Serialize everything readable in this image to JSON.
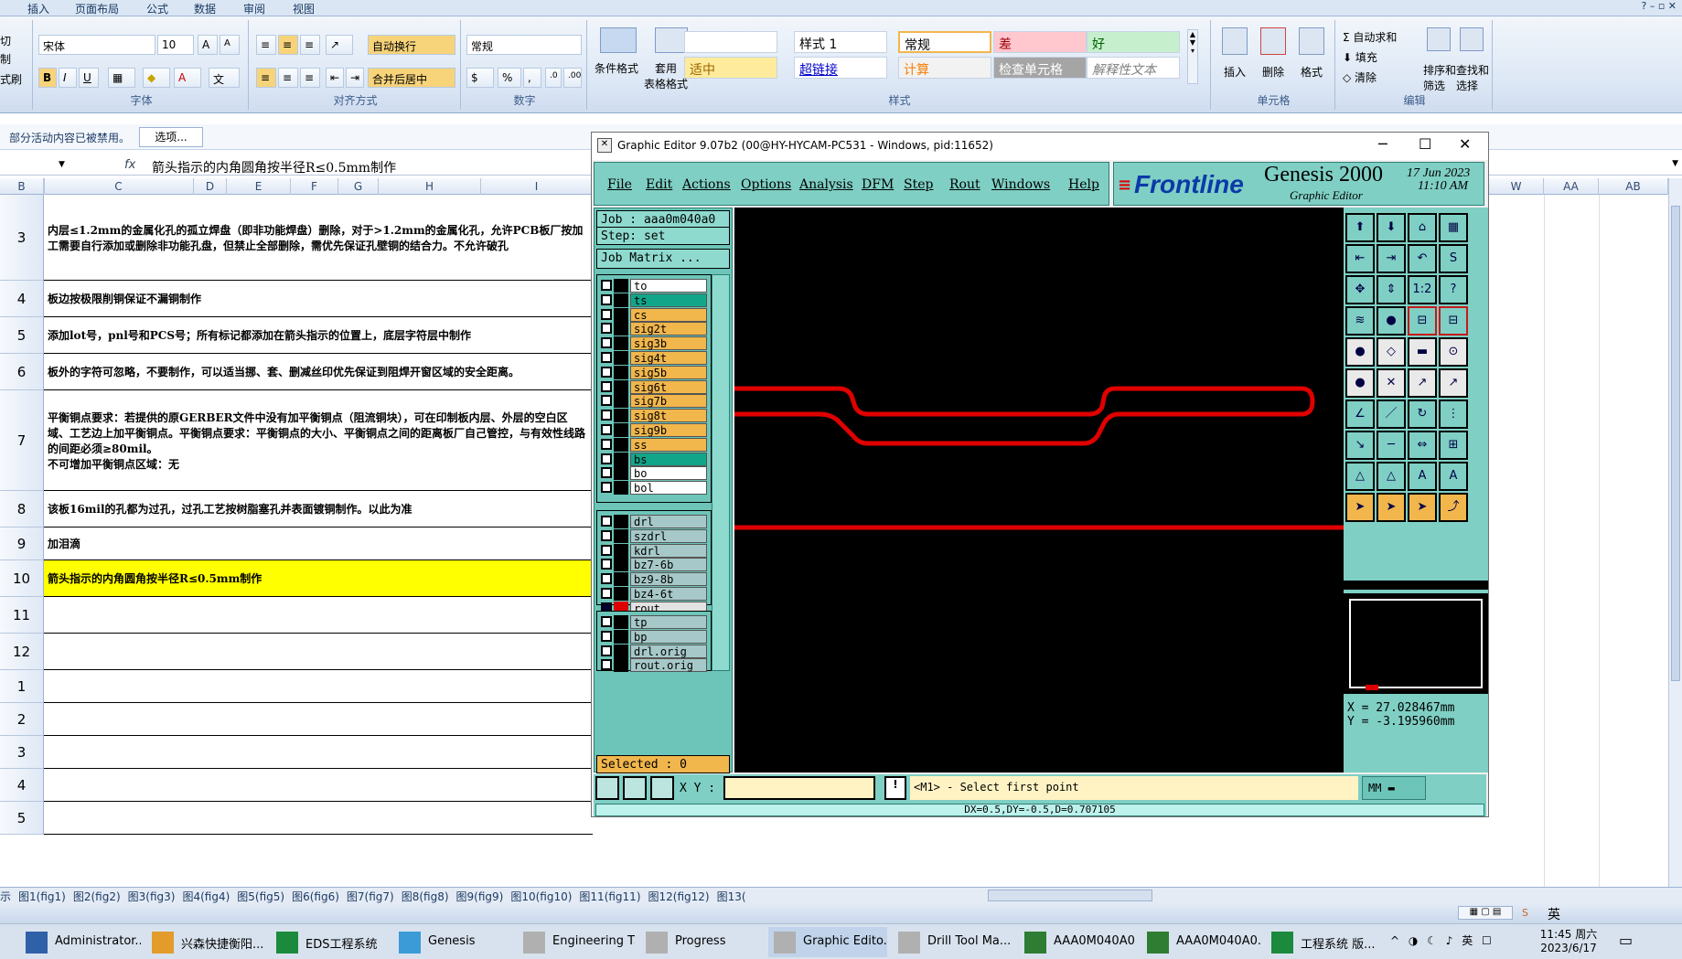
{
  "excel": {
    "tabs": [
      "插入",
      "页面布局",
      "公式",
      "数据",
      "审阅",
      "视图"
    ],
    "clipboard": {
      "cut": "切",
      "copy": "制",
      "format_painter": "式刷"
    },
    "font": {
      "name": "宋体",
      "size": "10",
      "group_label": "字体"
    },
    "alignment": {
      "wrap_text": "自动换行",
      "merge_center": "合并后居中",
      "group_label": "对齐方式"
    },
    "number": {
      "format": "常规",
      "group_label": "数字"
    },
    "styles": {
      "conditional_format": "条件格式",
      "table_format": "套用\n表格格式",
      "cells": [
        {
          "text": "",
          "bg": "#ffffff",
          "color": "#000000"
        },
        {
          "text": "样式 1",
          "bg": "#ffffff",
          "color": "#000000"
        },
        {
          "text": "常规",
          "bg": "#ffffff",
          "color": "#000000"
        },
        {
          "text": "差",
          "bg": "#ffc7ce",
          "color": "#9c0006"
        },
        {
          "text": "好",
          "bg": "#c6efce",
          "color": "#006100"
        },
        {
          "text": "适中",
          "bg": "#ffeb9c",
          "color": "#9c6500"
        },
        {
          "text": "超链接",
          "bg": "#ffffff",
          "color": "#0000cc"
        },
        {
          "text": "计算",
          "bg": "#f2f2f2",
          "color": "#fa7d00"
        },
        {
          "text": "检查单元格",
          "bg": "#a5a5a5",
          "color": "#ffffff"
        },
        {
          "text": "解释性文本",
          "bg": "#ffffff",
          "color": "#7f7f7f"
        }
      ],
      "group_label": "样式"
    },
    "cells_group": {
      "insert": "插入",
      "delete": "删除",
      "format": "格式",
      "group_label": "单元格"
    },
    "editing": {
      "autosum": "自动求和",
      "fill": "填充",
      "clear": "清除",
      "sort_filter": "排序和\n筛选",
      "find_select": "查找和\n选择",
      "group_label": "编辑"
    },
    "security_bar": {
      "message": "部分活动内容已被禁用。",
      "options_button": "选项..."
    },
    "formula_bar": {
      "fx": "fx",
      "content": "箭头指示的内角圆角按半径R≤0.5mm制作"
    },
    "columns": [
      "B",
      "C",
      "D",
      "E",
      "F",
      "G",
      "H",
      "I",
      "W",
      "AA",
      "AB"
    ],
    "rows": [
      {
        "num": "3",
        "text": "内层≤1.2mm的金属化孔的孤立焊盘（即非功能焊盘）删除，对于>1.2mm的金属化孔，允许PCB板厂按加工需要自行添加或删除非功能孔盘，但禁止全部删除，需优先保证孔壁铜的结合力。不允许破孔",
        "highlight": false
      },
      {
        "num": "4",
        "text": "板边按极限削铜保证不漏铜制作",
        "highlight": false
      },
      {
        "num": "5",
        "text": "添加lot号，pnl号和PCS号；所有标记都添加在箭头指示的位置上，底层字符层中制作",
        "highlight": false
      },
      {
        "num": "6",
        "text": "板外的字符可忽略，不要制作，可以适当挪、套、删减丝印优先保证到阻焊开窗区域的安全距离。",
        "highlight": false
      },
      {
        "num": "7",
        "text": "平衡铜点要求：若提供的原GERBER文件中没有加平衡铜点（阻流铜块），可在印制板内层、外层的空白区域、工艺边上加平衡铜点。平衡铜点要求：平衡铜点的大小、平衡铜点之间的距离板厂自己管控，与有效性线路的间距必须≥80mil。\n不可增加平衡铜点区域：无",
        "highlight": false
      },
      {
        "num": "8",
        "text": "该板16mil的孔都为过孔，过孔工艺按树脂塞孔并表面镀铜制作。以此为准",
        "highlight": false
      },
      {
        "num": "9",
        "text": "加泪滴",
        "highlight": false
      },
      {
        "num": "10",
        "text": "箭头指示的内角圆角按半径R≤0.5mm制作",
        "highlight": true
      },
      {
        "num": "11",
        "text": "",
        "highlight": false
      },
      {
        "num": "12",
        "text": "",
        "highlight": false
      },
      {
        "num": "1",
        "text": "",
        "highlight": false
      },
      {
        "num": "2",
        "text": "",
        "highlight": false
      },
      {
        "num": "3",
        "text": "",
        "highlight": false
      },
      {
        "num": "4",
        "text": "",
        "highlight": false
      },
      {
        "num": "5",
        "text": "",
        "highlight": false
      }
    ],
    "sheet_tabs": [
      "示",
      "图1(fig1)",
      "图2(fig2)",
      "图3(fig3)",
      "图4(fig4)",
      "图5(fig5)",
      "图6(fig6)",
      "图7(fig7)",
      "图8(fig8)",
      "图9(fig9)",
      "图10(fig10)",
      "图11(fig11)",
      "图12(fig12)",
      "图13("
    ]
  },
  "genesis": {
    "title": "Graphic Editor 9.07b2 (00@HY-HYCAM-PC531 - Windows, pid:11652)",
    "menu": [
      "File",
      "Edit",
      "Actions",
      "Options",
      "Analysis",
      "DFM",
      "Step",
      "Rout",
      "Windows",
      "Help"
    ],
    "logo": {
      "brand": "Frontline",
      "product": "Genesis 2000",
      "subtitle": "Graphic Editor",
      "date": "17 Jun 2023",
      "time": "11:10 AM"
    },
    "job": "Job : aaa0m040a0",
    "step": "Step: set",
    "job_matrix": "Job Matrix ...",
    "layers_board": [
      {
        "name": "to",
        "color": "#ffffff"
      },
      {
        "name": "ts",
        "color": "#13a58a"
      },
      {
        "name": "cs",
        "color": "#f1b64c"
      },
      {
        "name": "sig2t",
        "color": "#f1b64c"
      },
      {
        "name": "sig3b",
        "color": "#f1b64c"
      },
      {
        "name": "sig4t",
        "color": "#f1b64c"
      },
      {
        "name": "sig5b",
        "color": "#f1b64c"
      },
      {
        "name": "sig6t",
        "color": "#f1b64c"
      },
      {
        "name": "sig7b",
        "color": "#f1b64c"
      },
      {
        "name": "sig8t",
        "color": "#f1b64c"
      },
      {
        "name": "sig9b",
        "color": "#f1b64c"
      },
      {
        "name": "ss",
        "color": "#f1b64c"
      },
      {
        "name": "bs",
        "color": "#13a58a"
      },
      {
        "name": "bo",
        "color": "#ffffff"
      },
      {
        "name": "bol",
        "color": "#ffffff"
      }
    ],
    "layers_drill": [
      {
        "name": "drl",
        "color": "#a6c8c8"
      },
      {
        "name": "szdrl",
        "color": "#a6c8c8"
      },
      {
        "name": "kdrl",
        "color": "#a6c8c8"
      },
      {
        "name": "bz7-6b",
        "color": "#a6c8c8"
      },
      {
        "name": "bz9-8b",
        "color": "#a6c8c8"
      },
      {
        "name": "bz4-6t",
        "color": "#a6c8c8"
      },
      {
        "name": "rout",
        "color": "#e2e2e2"
      }
    ],
    "layers_misc": [
      {
        "name": "tp",
        "color": "#a6c8c8"
      },
      {
        "name": "bp",
        "color": "#a6c8c8"
      },
      {
        "name": "drl.orig",
        "color": "#a6c8c8"
      },
      {
        "name": "rout.orig",
        "color": "#a6c8c8"
      }
    ],
    "selected": "Selected : 0",
    "coords": {
      "x": "X = 27.028467mm",
      "y": "Y = -3.195960mm"
    },
    "xy_label": "X Y :",
    "xy_value": "",
    "prompt": "<M1> - Select first point",
    "units": "MM",
    "measure": "DX=0.5,DY=-0.5,D=0.707105",
    "trace_color": "#e00000"
  },
  "taskbar": {
    "items": [
      "Administrator...",
      "兴森快捷衡阳...",
      "EDS工程系统",
      "Genesis",
      "Engineering T...",
      "Progress",
      "Graphic Edito...",
      "Drill Tool Ma...",
      "AAA0M040A0...",
      "AAA0M040A0...",
      "工程系统  版..."
    ],
    "ime": "英",
    "time": "11:45 周六",
    "date": "2023/6/17"
  }
}
